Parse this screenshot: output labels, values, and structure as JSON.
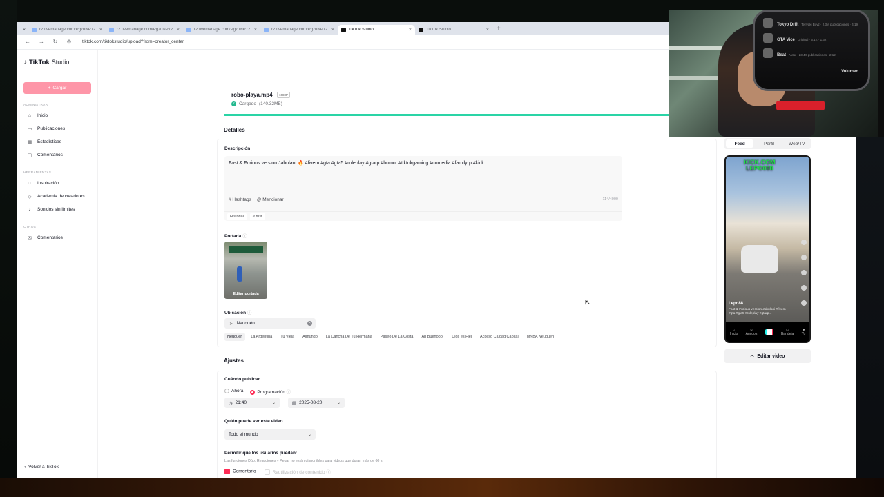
{
  "browser": {
    "tabs": [
      {
        "label": "r2.fivemanage.com/PgzuNP72...",
        "active": false
      },
      {
        "label": "r2.fivemanage.com/PgzuNP72...",
        "active": false
      },
      {
        "label": "r2.fivemanage.com/PgzuNP72...",
        "active": false
      },
      {
        "label": "r2.fivemanage.com/PgzuNP72...",
        "active": false
      },
      {
        "label": "TikTok Studio",
        "active": true
      },
      {
        "label": "TikTok Studio",
        "active": false
      }
    ],
    "url": "tiktok.com/tiktokstudio/upload?from=creator_center"
  },
  "sidebar": {
    "logo_brand": "TikTok",
    "logo_product": "Studio",
    "upload_label": "Cargar",
    "section_admin": "ADMINISTRAR",
    "admin_items": [
      {
        "label": "Inicio",
        "icon": "home-icon"
      },
      {
        "label": "Publicaciones",
        "icon": "posts-icon"
      },
      {
        "label": "Estadísticas",
        "icon": "analytics-icon"
      },
      {
        "label": "Comentarios",
        "icon": "comments-icon"
      }
    ],
    "section_tools": "HERRAMIENTAS",
    "tools_items": [
      {
        "label": "Inspiración",
        "icon": "bulb-icon"
      },
      {
        "label": "Academia de creadores",
        "icon": "academy-icon"
      },
      {
        "label": "Sonidos sin límites",
        "icon": "music-icon"
      }
    ],
    "section_other": "OTROS",
    "other_items": [
      {
        "label": "Comentarios",
        "icon": "feedback-icon"
      }
    ],
    "back_label": "Volver a TikTok"
  },
  "file": {
    "name": "robo-playa.mp4",
    "resolution": "1080P",
    "status": "Cargado",
    "size": "(140.32MB)"
  },
  "details": {
    "title": "Detalles",
    "description_label": "Descripción",
    "description_text": "Fast & Furious version Jabulani 🔥 #fivem #gta #gta5 #roleplay #gtarp #humor #tiktokgaming #comedia #familyrp #kick",
    "hashtags_label": "Hashtags",
    "mention_label": "Mencionar",
    "char_count": "114/4000",
    "sub_chips": [
      "Historial",
      "# rust"
    ],
    "cover_label": "Portada",
    "cover_edit": "Editar portada",
    "location_label": "Ubicación",
    "location_value": "Neuquén",
    "location_chips": [
      "Neuquén",
      "La Argentina",
      "Tu Vieja",
      "Almundo",
      "La Cancha De Tu Hermana",
      "Paseo De La Costa",
      "Ah Buenooo.",
      "Dios es Fiel",
      "Acceso Ciudad Capital",
      "MNBA Neuquén"
    ]
  },
  "settings": {
    "title": "Ajustes",
    "when_label": "Cuándo publicar",
    "now_label": "Ahora",
    "schedule_label": "Programación",
    "time_value": "21:40",
    "date_value": "2025-08-20",
    "who_label": "Quién puede ver este video",
    "who_value": "Todo el mundo",
    "allow_label": "Permitir que los usuarios puedan:",
    "allow_note": "Las funciones Dúo, Reacciones y Pegar no están disponibles para videos que duran más de 60 s.",
    "comment_label": "Comentario",
    "reuse_label": "Reutilización de contenido"
  },
  "preview": {
    "tabs": [
      "Feed",
      "Perfil",
      "Web/TV"
    ],
    "banner_line1": "KICK.COM",
    "banner_line2": "LEPO088",
    "username": "Lepo88",
    "caption": "Fast & Furious version Jabulani #fivem #gta #gta5 #roleplay #gtarp...",
    "nav_items": [
      "Inicio",
      "Amigos",
      "",
      "Bandeja",
      "Yo"
    ],
    "edit_video_label": "Editar video"
  },
  "webcam": {
    "rows": [
      {
        "title": "Tokyo Drift",
        "sub": "Teriyaki Boyz · 2.3M publicaciones · 4:19"
      },
      {
        "title": "GTA Vice",
        "sub": "Original · 5.1K · 1:32"
      },
      {
        "title": "Beat",
        "sub": "Autor · 23.4K publicaciones · 2:12"
      }
    ],
    "action": "Volumen"
  }
}
